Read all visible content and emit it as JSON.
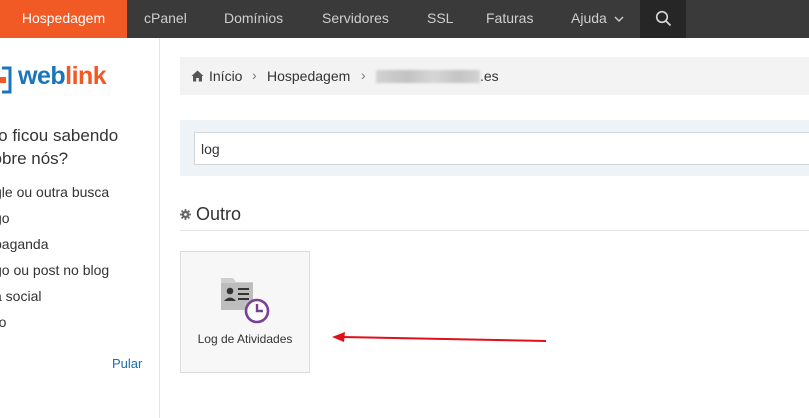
{
  "nav": {
    "items": [
      {
        "label": "Hospedagem",
        "active": true
      },
      {
        "label": "cPanel"
      },
      {
        "label": "Domínios"
      },
      {
        "label": "Servidores"
      },
      {
        "label": "SSL"
      },
      {
        "label": "Faturas"
      },
      {
        "label": "Ajuda"
      }
    ]
  },
  "sidebar": {
    "logo_text_web": "web",
    "logo_text_link": "link",
    "survey_question": "mo ficou sabendo sobre nós?",
    "options": [
      "gle ou outra busca",
      "go",
      "paganda",
      "go ou post no blog",
      "a social",
      "ro"
    ],
    "skip_label": "Pular"
  },
  "breadcrumb": {
    "home": "Início",
    "section": "Hospedagem",
    "domain_suffix": ".es"
  },
  "search": {
    "value": "log"
  },
  "section": {
    "title": "Outro"
  },
  "tile": {
    "label": "Log de Atividades"
  },
  "colors": {
    "accent": "#f15a24",
    "nav_bg": "#3a3a3a",
    "link": "#1a6fa8",
    "annotation_arrow": "#e0101a",
    "icon_purple": "#7b3f96"
  }
}
